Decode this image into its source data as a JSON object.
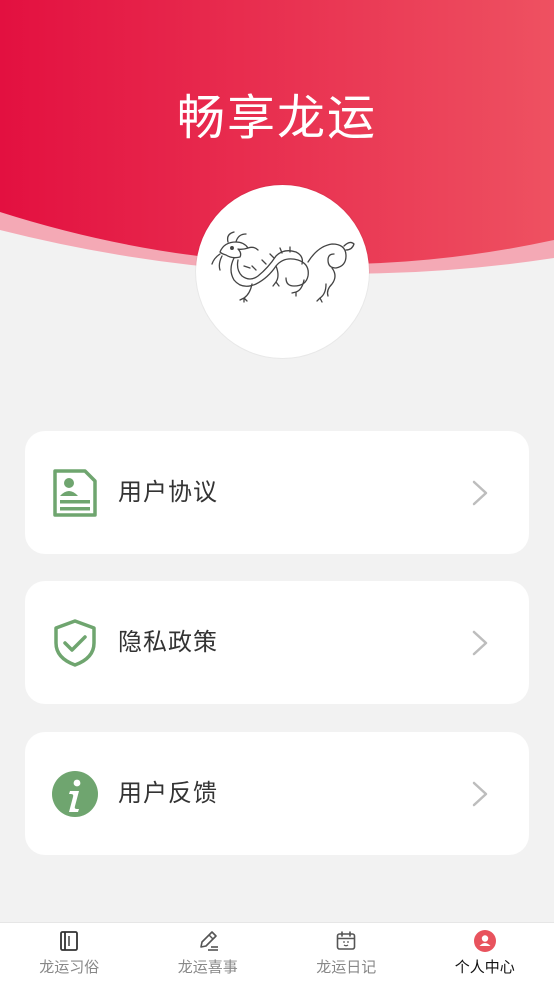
{
  "header": {
    "title": "畅享龙运",
    "gradient_start": "#e31040",
    "gradient_end": "#ee5161"
  },
  "avatar": {
    "icon": "dragon-illustration"
  },
  "menu": [
    {
      "label": "用户协议",
      "icon": "document-icon"
    },
    {
      "label": "隐私政策",
      "icon": "shield-check-icon"
    },
    {
      "label": "用户反馈",
      "icon": "info-icon"
    }
  ],
  "accent_color": "#6fa56f",
  "tabs": [
    {
      "label": "龙运习俗",
      "icon": "book-icon",
      "active": false
    },
    {
      "label": "龙运喜事",
      "icon": "edit-icon",
      "active": false
    },
    {
      "label": "龙运日记",
      "icon": "calendar-icon",
      "active": false
    },
    {
      "label": "个人中心",
      "icon": "user-icon",
      "active": true
    }
  ]
}
